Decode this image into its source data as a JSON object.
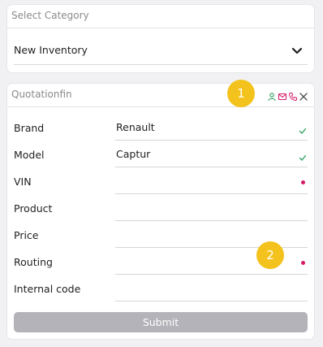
{
  "category_card": {
    "title": "Select Category",
    "selected_value": "New Inventory"
  },
  "quotation_card": {
    "title": "Quotationfin",
    "header_icons": [
      "user-icon",
      "mail-icon",
      "phone-icon",
      "close-icon"
    ],
    "fields": [
      {
        "label": "Brand",
        "value": "Renault",
        "status": "valid"
      },
      {
        "label": "Model",
        "value": "Captur",
        "status": "valid"
      },
      {
        "label": "VIN",
        "value": "",
        "status": "required"
      },
      {
        "label": "Product",
        "value": "",
        "status": ""
      },
      {
        "label": "Price",
        "value": "",
        "status": ""
      },
      {
        "label": "Routing",
        "value": "",
        "status": "required"
      },
      {
        "label": "Internal code",
        "value": "",
        "status": ""
      }
    ],
    "submit_label": "Submit"
  },
  "markers": [
    "1",
    "2"
  ],
  "colors": {
    "accent_pink": "#d61a6a",
    "valid_green": "#2a9d5c",
    "marker_yellow": "#f4c21c",
    "submit_disabled": "#b3b3b9"
  }
}
